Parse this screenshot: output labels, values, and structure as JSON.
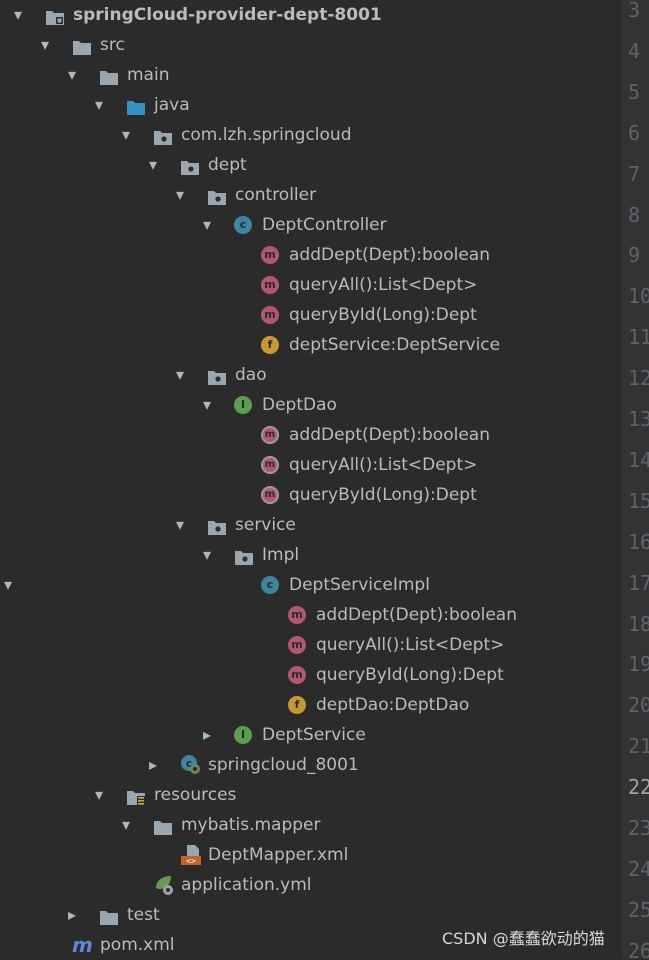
{
  "tree": {
    "rows": [
      {
        "label": "springCloud-provider-dept-8001",
        "icon": "module-folder-icon",
        "arrow": "down",
        "bold": true
      },
      {
        "label": "src",
        "icon": "folder-icon",
        "arrow": "down"
      },
      {
        "label": "main",
        "icon": "folder-icon",
        "arrow": "down"
      },
      {
        "label": "java",
        "icon": "source-root-folder-icon",
        "arrow": "down"
      },
      {
        "label": "com.lzh.springcloud",
        "icon": "package-icon",
        "arrow": "down"
      },
      {
        "label": "dept",
        "icon": "package-icon",
        "arrow": "down"
      },
      {
        "label": "controller",
        "icon": "package-icon",
        "arrow": "down"
      },
      {
        "label": "DeptController",
        "icon": "class-icon",
        "arrow": "down"
      },
      {
        "label": "addDept(Dept):boolean",
        "icon": "method-icon"
      },
      {
        "label": "queryAll():List<Dept>",
        "icon": "method-icon"
      },
      {
        "label": "queryById(Long):Dept",
        "icon": "method-icon"
      },
      {
        "label": "deptService:DeptService",
        "icon": "field-icon"
      },
      {
        "label": "dao",
        "icon": "package-icon",
        "arrow": "down"
      },
      {
        "label": "DeptDao",
        "icon": "interface-icon",
        "arrow": "down"
      },
      {
        "label": "addDept(Dept):boolean",
        "icon": "abstract-method-icon"
      },
      {
        "label": "queryAll():List<Dept>",
        "icon": "abstract-method-icon"
      },
      {
        "label": "queryById(Long):Dept",
        "icon": "abstract-method-icon"
      },
      {
        "label": "service",
        "icon": "package-icon",
        "arrow": "down"
      },
      {
        "label": "Impl",
        "icon": "package-icon",
        "arrow": "down"
      },
      {
        "label": "DeptServiceImpl",
        "icon": "class-icon",
        "arrow": "down"
      },
      {
        "label": "addDept(Dept):boolean",
        "icon": "method-icon"
      },
      {
        "label": "queryAll():List<Dept>",
        "icon": "method-icon"
      },
      {
        "label": "queryById(Long):Dept",
        "icon": "method-icon"
      },
      {
        "label": "deptDao:DeptDao",
        "icon": "field-icon"
      },
      {
        "label": "DeptService",
        "icon": "interface-icon",
        "arrow": "right"
      },
      {
        "label": "springcloud_8001",
        "icon": "spring-boot-class-icon",
        "arrow": "right"
      },
      {
        "label": "resources",
        "icon": "resources-folder-icon",
        "arrow": "down"
      },
      {
        "label": "mybatis.mapper",
        "icon": "folder-icon",
        "arrow": "down"
      },
      {
        "label": "DeptMapper.xml",
        "icon": "xml-file-icon"
      },
      {
        "label": "application.yml",
        "icon": "spring-config-file-icon"
      },
      {
        "label": "test",
        "icon": "folder-icon",
        "arrow": "right"
      },
      {
        "label": "pom.xml",
        "icon": "maven-icon"
      }
    ]
  },
  "gutter": {
    "numbers": [
      "3",
      "4",
      "5",
      "6",
      "7",
      "8",
      "9",
      "10",
      "11",
      "12",
      "13",
      "14",
      "15",
      "16",
      "17",
      "18",
      "19",
      "20",
      "21",
      "22",
      "23",
      "24",
      "25",
      "26"
    ],
    "current": "22"
  },
  "watermark": "CSDN @蠢蠢欲动的猫"
}
